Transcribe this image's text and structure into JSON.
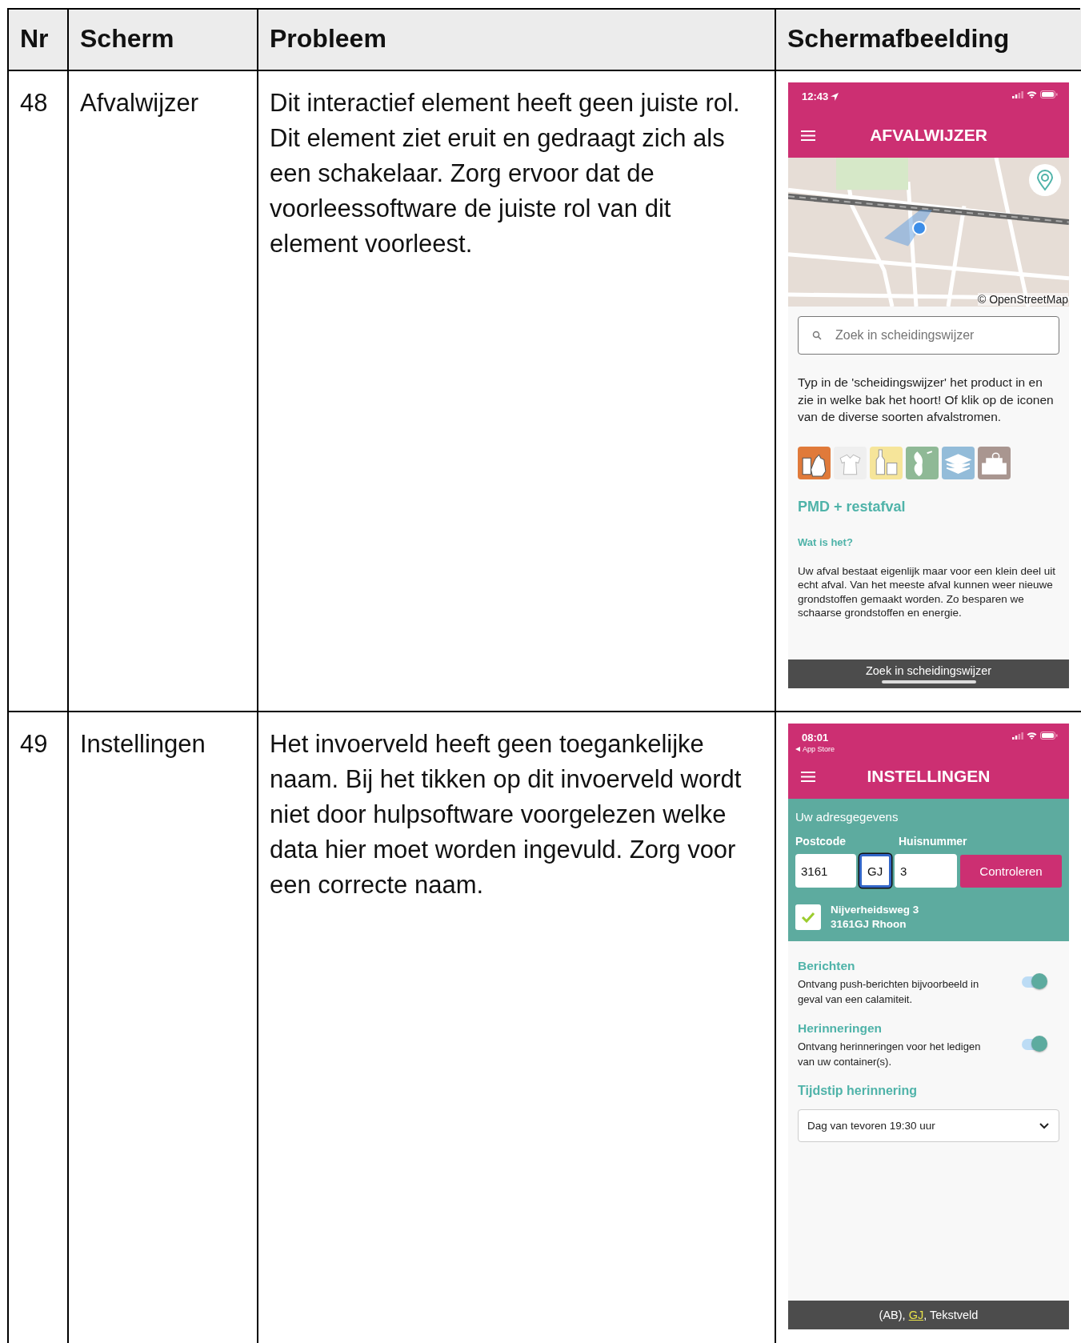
{
  "columns": [
    "Nr",
    "Scherm",
    "Probleem",
    "Schermafbeelding"
  ],
  "rows": [
    {
      "nr": "48",
      "screen": "Afvalwijzer",
      "problem": "Dit interactief element heeft geen juiste rol. Dit element ziet eruit en gedraagt zich als een schakelaar. Zorg ervoor dat de voorleessoftware de juiste rol van dit element voorleest.",
      "screenshot": {
        "kind": "afvalwijzer",
        "time": "12:43",
        "title": "AFVALWIJZER",
        "map_attribution": "© OpenStreetMap",
        "search": {
          "placeholder": "Zoek in scheidingswijzer"
        },
        "intro": "Typ in de 'scheidingswijzer' het product in en zie in welke bak het hoort! Of klik op de iconen van de diverse soorten afvalstromen.",
        "categories": [
          {
            "kind": "bag",
            "color": "#e07a3a"
          },
          {
            "kind": "shirt",
            "color": "#efefef"
          },
          {
            "kind": "bottle",
            "color": "#f6e59a"
          },
          {
            "kind": "apple",
            "color": "#8fb996"
          },
          {
            "kind": "paper",
            "color": "#93bcd9"
          },
          {
            "kind": "chair",
            "color": "#a99690"
          }
        ],
        "heading": "PMD + restafval",
        "subheading": "Wat is het?",
        "body": "Uw afval bestaat eigenlijk maar voor een klein deel uit echt afval. Van het meeste afval kunnen weer nieuwe grondstoffen gemaakt worden. Zo besparen we schaarse grondstoffen en energie.",
        "caption": "Zoek in scheidingswijzer"
      }
    },
    {
      "nr": "49",
      "screen": "Instellingen",
      "problem": "Het invoerveld heeft geen toegankelijke naam. Bij het tikken op dit invoerveld wordt niet door hulpsoftware voorgelezen welke data hier moet worden ingevuld. Zorg voor een correcte naam.",
      "screenshot": {
        "kind": "instellingen",
        "time": "08:01",
        "back": "App Store",
        "title": "INSTELLINGEN",
        "address_heading": "Uw adresgegevens",
        "postcode_label": "Postcode",
        "house_label": "Huisnummer",
        "fields": [
          {
            "kind": "postcode",
            "value": "3161",
            "focused": false
          },
          {
            "kind": "letters",
            "value": "GJ",
            "focused": true
          },
          {
            "kind": "house",
            "value": "3",
            "focused": false
          }
        ],
        "check_button": "Controleren",
        "verified": {
          "checked": true,
          "line1": "Nijverheidsweg 3",
          "line2": "3161GJ Rhoon"
        },
        "toggles": [
          {
            "title": "Berichten",
            "description": "Ontvang push-berichten bijvoorbeeld in geval van een calamiteit.",
            "on": true
          },
          {
            "title": "Herinneringen",
            "description": "Ontvang herinneringen voor het ledigen van uw container(s).",
            "on": true
          }
        ],
        "time_heading": "Tijdstip herinnering",
        "time_select": "Dag van tevoren 19:30 uur",
        "caption": {
          "before": "(AB), ",
          "highlight": "GJ",
          "after": ", Tekstveld"
        }
      }
    }
  ]
}
